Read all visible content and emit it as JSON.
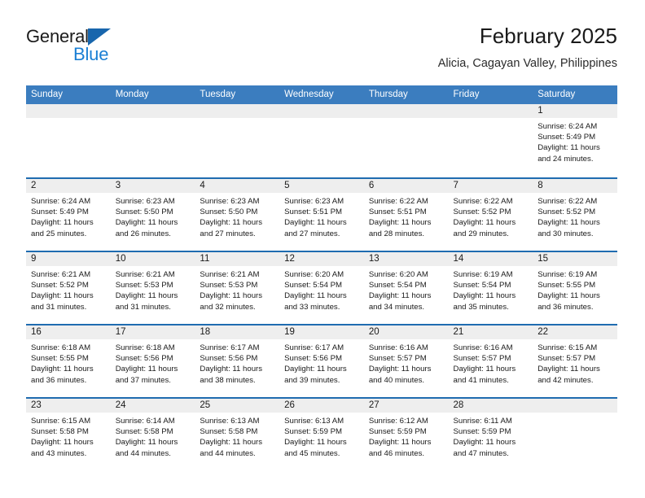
{
  "brand": {
    "name_part1": "General",
    "name_part2": "Blue",
    "logo_icon": "triangle-icon",
    "accent_blue": "#1a7fd4",
    "triangle_blue": "#1866ad"
  },
  "header": {
    "title": "February 2025",
    "subtitle": "Alicia, Cagayan Valley, Philippines"
  },
  "theme": {
    "header_row_bg": "#3b7dbf",
    "daynum_band_bg": "#eeeeee",
    "week_divider": "#1f6cb0"
  },
  "calendar": {
    "weekdays": [
      "Sunday",
      "Monday",
      "Tuesday",
      "Wednesday",
      "Thursday",
      "Friday",
      "Saturday"
    ],
    "weeks": [
      [
        {
          "day": "",
          "sunrise": "",
          "sunset": "",
          "daylight": "",
          "empty": true
        },
        {
          "day": "",
          "sunrise": "",
          "sunset": "",
          "daylight": "",
          "empty": true
        },
        {
          "day": "",
          "sunrise": "",
          "sunset": "",
          "daylight": "",
          "empty": true
        },
        {
          "day": "",
          "sunrise": "",
          "sunset": "",
          "daylight": "",
          "empty": true
        },
        {
          "day": "",
          "sunrise": "",
          "sunset": "",
          "daylight": "",
          "empty": true
        },
        {
          "day": "",
          "sunrise": "",
          "sunset": "",
          "daylight": "",
          "empty": true
        },
        {
          "day": "1",
          "sunrise": "Sunrise: 6:24 AM",
          "sunset": "Sunset: 5:49 PM",
          "daylight": "Daylight: 11 hours and 24 minutes."
        }
      ],
      [
        {
          "day": "2",
          "sunrise": "Sunrise: 6:24 AM",
          "sunset": "Sunset: 5:49 PM",
          "daylight": "Daylight: 11 hours and 25 minutes."
        },
        {
          "day": "3",
          "sunrise": "Sunrise: 6:23 AM",
          "sunset": "Sunset: 5:50 PM",
          "daylight": "Daylight: 11 hours and 26 minutes."
        },
        {
          "day": "4",
          "sunrise": "Sunrise: 6:23 AM",
          "sunset": "Sunset: 5:50 PM",
          "daylight": "Daylight: 11 hours and 27 minutes."
        },
        {
          "day": "5",
          "sunrise": "Sunrise: 6:23 AM",
          "sunset": "Sunset: 5:51 PM",
          "daylight": "Daylight: 11 hours and 27 minutes."
        },
        {
          "day": "6",
          "sunrise": "Sunrise: 6:22 AM",
          "sunset": "Sunset: 5:51 PM",
          "daylight": "Daylight: 11 hours and 28 minutes."
        },
        {
          "day": "7",
          "sunrise": "Sunrise: 6:22 AM",
          "sunset": "Sunset: 5:52 PM",
          "daylight": "Daylight: 11 hours and 29 minutes."
        },
        {
          "day": "8",
          "sunrise": "Sunrise: 6:22 AM",
          "sunset": "Sunset: 5:52 PM",
          "daylight": "Daylight: 11 hours and 30 minutes."
        }
      ],
      [
        {
          "day": "9",
          "sunrise": "Sunrise: 6:21 AM",
          "sunset": "Sunset: 5:52 PM",
          "daylight": "Daylight: 11 hours and 31 minutes."
        },
        {
          "day": "10",
          "sunrise": "Sunrise: 6:21 AM",
          "sunset": "Sunset: 5:53 PM",
          "daylight": "Daylight: 11 hours and 31 minutes."
        },
        {
          "day": "11",
          "sunrise": "Sunrise: 6:21 AM",
          "sunset": "Sunset: 5:53 PM",
          "daylight": "Daylight: 11 hours and 32 minutes."
        },
        {
          "day": "12",
          "sunrise": "Sunrise: 6:20 AM",
          "sunset": "Sunset: 5:54 PM",
          "daylight": "Daylight: 11 hours and 33 minutes."
        },
        {
          "day": "13",
          "sunrise": "Sunrise: 6:20 AM",
          "sunset": "Sunset: 5:54 PM",
          "daylight": "Daylight: 11 hours and 34 minutes."
        },
        {
          "day": "14",
          "sunrise": "Sunrise: 6:19 AM",
          "sunset": "Sunset: 5:54 PM",
          "daylight": "Daylight: 11 hours and 35 minutes."
        },
        {
          "day": "15",
          "sunrise": "Sunrise: 6:19 AM",
          "sunset": "Sunset: 5:55 PM",
          "daylight": "Daylight: 11 hours and 36 minutes."
        }
      ],
      [
        {
          "day": "16",
          "sunrise": "Sunrise: 6:18 AM",
          "sunset": "Sunset: 5:55 PM",
          "daylight": "Daylight: 11 hours and 36 minutes."
        },
        {
          "day": "17",
          "sunrise": "Sunrise: 6:18 AM",
          "sunset": "Sunset: 5:56 PM",
          "daylight": "Daylight: 11 hours and 37 minutes."
        },
        {
          "day": "18",
          "sunrise": "Sunrise: 6:17 AM",
          "sunset": "Sunset: 5:56 PM",
          "daylight": "Daylight: 11 hours and 38 minutes."
        },
        {
          "day": "19",
          "sunrise": "Sunrise: 6:17 AM",
          "sunset": "Sunset: 5:56 PM",
          "daylight": "Daylight: 11 hours and 39 minutes."
        },
        {
          "day": "20",
          "sunrise": "Sunrise: 6:16 AM",
          "sunset": "Sunset: 5:57 PM",
          "daylight": "Daylight: 11 hours and 40 minutes."
        },
        {
          "day": "21",
          "sunrise": "Sunrise: 6:16 AM",
          "sunset": "Sunset: 5:57 PM",
          "daylight": "Daylight: 11 hours and 41 minutes."
        },
        {
          "day": "22",
          "sunrise": "Sunrise: 6:15 AM",
          "sunset": "Sunset: 5:57 PM",
          "daylight": "Daylight: 11 hours and 42 minutes."
        }
      ],
      [
        {
          "day": "23",
          "sunrise": "Sunrise: 6:15 AM",
          "sunset": "Sunset: 5:58 PM",
          "daylight": "Daylight: 11 hours and 43 minutes."
        },
        {
          "day": "24",
          "sunrise": "Sunrise: 6:14 AM",
          "sunset": "Sunset: 5:58 PM",
          "daylight": "Daylight: 11 hours and 44 minutes."
        },
        {
          "day": "25",
          "sunrise": "Sunrise: 6:13 AM",
          "sunset": "Sunset: 5:58 PM",
          "daylight": "Daylight: 11 hours and 44 minutes."
        },
        {
          "day": "26",
          "sunrise": "Sunrise: 6:13 AM",
          "sunset": "Sunset: 5:59 PM",
          "daylight": "Daylight: 11 hours and 45 minutes."
        },
        {
          "day": "27",
          "sunrise": "Sunrise: 6:12 AM",
          "sunset": "Sunset: 5:59 PM",
          "daylight": "Daylight: 11 hours and 46 minutes."
        },
        {
          "day": "28",
          "sunrise": "Sunrise: 6:11 AM",
          "sunset": "Sunset: 5:59 PM",
          "daylight": "Daylight: 11 hours and 47 minutes."
        },
        {
          "day": "",
          "sunrise": "",
          "sunset": "",
          "daylight": "",
          "empty": true
        }
      ]
    ]
  }
}
